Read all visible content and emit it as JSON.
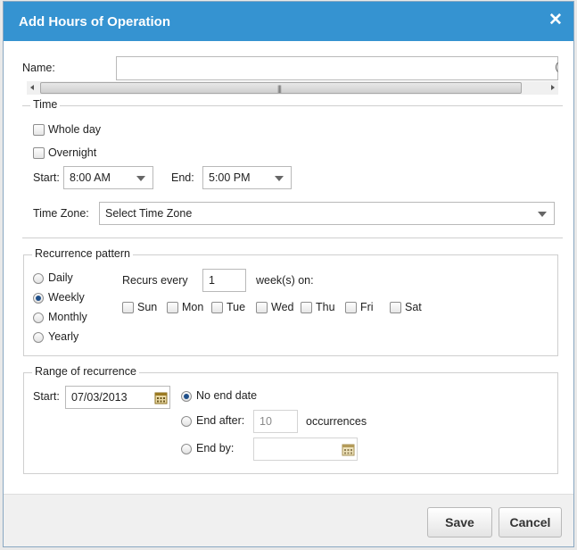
{
  "dialog": {
    "title": "Add Hours of Operation",
    "close_glyph": "✕"
  },
  "name": {
    "label": "Name:",
    "value": "",
    "trailing_char": "("
  },
  "time": {
    "legend": "Time",
    "whole_day_label": "Whole day",
    "whole_day_checked": false,
    "overnight_label": "Overnight",
    "overnight_checked": false,
    "start_label": "Start:",
    "start_value": "8:00 AM",
    "end_label": "End:",
    "end_value": "5:00 PM",
    "timezone_label": "Time Zone:",
    "timezone_value": "Select Time Zone"
  },
  "recurrence": {
    "legend": "Recurrence pattern",
    "options": [
      "Daily",
      "Weekly",
      "Monthly",
      "Yearly"
    ],
    "selected": "Weekly",
    "recurs_every_label": "Recurs every",
    "recurs_every_value": "1",
    "weeks_on_label": "week(s) on:",
    "days": [
      "Sun",
      "Mon",
      "Tue",
      "Wed",
      "Thu",
      "Fri",
      "Sat"
    ]
  },
  "range": {
    "legend": "Range of recurrence",
    "start_label": "Start:",
    "start_value": "07/03/2013",
    "no_end_label": "No end date",
    "end_after_label": "End after:",
    "end_after_value": "10",
    "occurrences_label": "occurrences",
    "end_by_label": "End by:",
    "end_by_value": "",
    "selected": "No end date"
  },
  "footer": {
    "save_label": "Save",
    "cancel_label": "Cancel"
  },
  "icons": {
    "calendar": "calendar-icon",
    "close": "close-icon",
    "dropdown": "chevron-down-icon"
  },
  "colors": {
    "titlebar": "#3593d1",
    "accent_radio": "#1f4f8a"
  }
}
